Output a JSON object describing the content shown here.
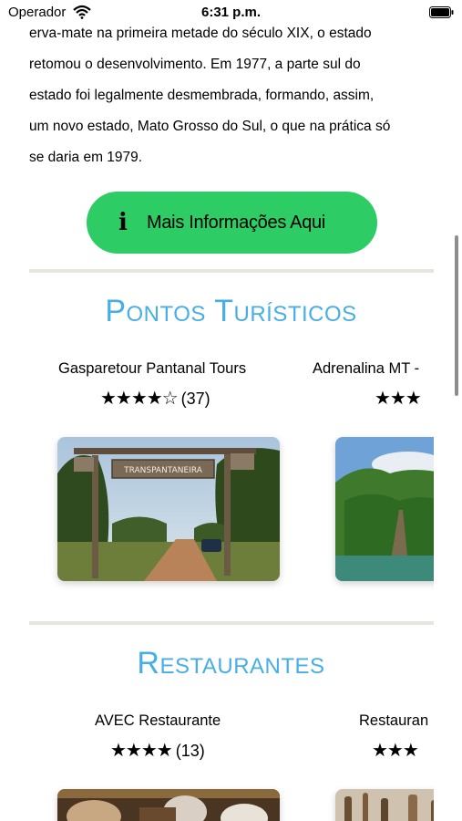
{
  "status_bar": {
    "carrier": "Operador",
    "time": "6:31 p.m."
  },
  "article": {
    "lines": [
      "erva-mate na primeira metade do século XIX, o estado",
      "retomou o desenvolvimento. Em 1977, a parte sul do",
      "estado foi legalmente desmembrada, formando, assim,",
      "um novo estado, Mato Grosso do Sul, o que na prática só",
      "se daria em 1979."
    ]
  },
  "info_button": {
    "icon": "i",
    "label": "Mais Informações Aqui",
    "color": "#2ecc64"
  },
  "tourist_section": {
    "title": "Pontos Turísticos",
    "cards": [
      {
        "name": "Gasparetour Pantanal Tours",
        "stars": "★★★★☆",
        "count": "(37)",
        "image": "pantanal-gate-photo",
        "sign": "TRANSPANTANEIRA"
      },
      {
        "name": "Adrenalina MT - ",
        "stars": "★★★",
        "image": "forest-tree-photo"
      }
    ]
  },
  "restaurant_section": {
    "title": "Restaurantes",
    "cards": [
      {
        "name": "AVEC Restaurante",
        "stars": "★★★★",
        "count": "(13)",
        "image": "restaurant-interior-photo"
      },
      {
        "name": "Restauran",
        "stars": "★★★",
        "image": "restaurant-decor-photo"
      }
    ]
  },
  "colors": {
    "accent": "#48aee4",
    "button": "#2ecc64",
    "divider": "#e8e5e1"
  }
}
